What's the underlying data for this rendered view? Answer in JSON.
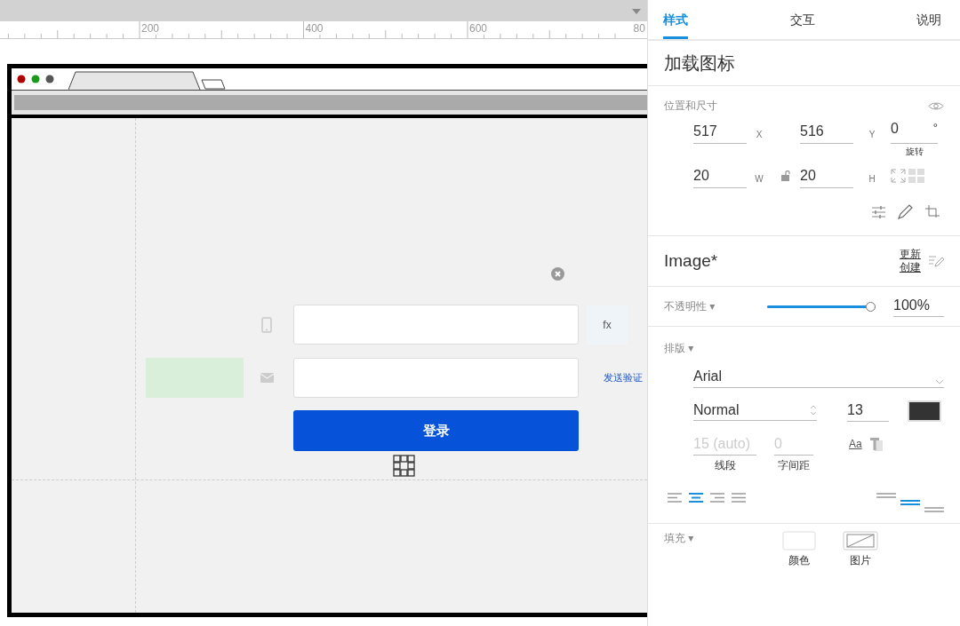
{
  "ruler": {
    "labels": [
      "200",
      "400",
      "600",
      "80"
    ]
  },
  "mockup": {
    "fx_label": "fx",
    "send_code_link": "发送验证",
    "login_button": "登录"
  },
  "panel": {
    "tabs": [
      {
        "label": "样式",
        "selected": true
      },
      {
        "label": "交互",
        "selected": false
      },
      {
        "label": "说明",
        "selected": false
      }
    ],
    "title": "加载图标",
    "position": {
      "label": "位置和尺寸",
      "x": {
        "value": "517",
        "axis": "X"
      },
      "y": {
        "value": "516",
        "axis": "Y"
      },
      "rotation": {
        "value": "0",
        "unit": "°",
        "label": "旋转"
      },
      "w": {
        "value": "20",
        "axis": "W"
      },
      "h": {
        "value": "20",
        "axis": "H"
      }
    },
    "component": {
      "name": "Image*",
      "links": [
        "更新",
        "创建"
      ]
    },
    "opacity": {
      "label": "不透明性 ▾",
      "level": 1,
      "value": "100%"
    },
    "typography": {
      "label": "排版 ▾",
      "font": "Arial",
      "style": "Normal",
      "size": "13",
      "line_spacing": {
        "placeholder": "15 (auto)",
        "label": "线段"
      },
      "char_spacing": {
        "placeholder": "0",
        "label": "字间距"
      },
      "case_icon": "Aa",
      "h_align": [
        {
          "selected": false
        },
        {
          "selected": true
        },
        {
          "selected": false
        },
        {
          "selected": false
        }
      ],
      "v_align": [
        {
          "selected": false
        },
        {
          "selected": true
        },
        {
          "selected": false
        }
      ]
    },
    "fill": {
      "label": "填充 ▾",
      "options": [
        {
          "label": "颜色",
          "kind": "color"
        },
        {
          "label": "图片",
          "kind": "image"
        }
      ]
    }
  }
}
